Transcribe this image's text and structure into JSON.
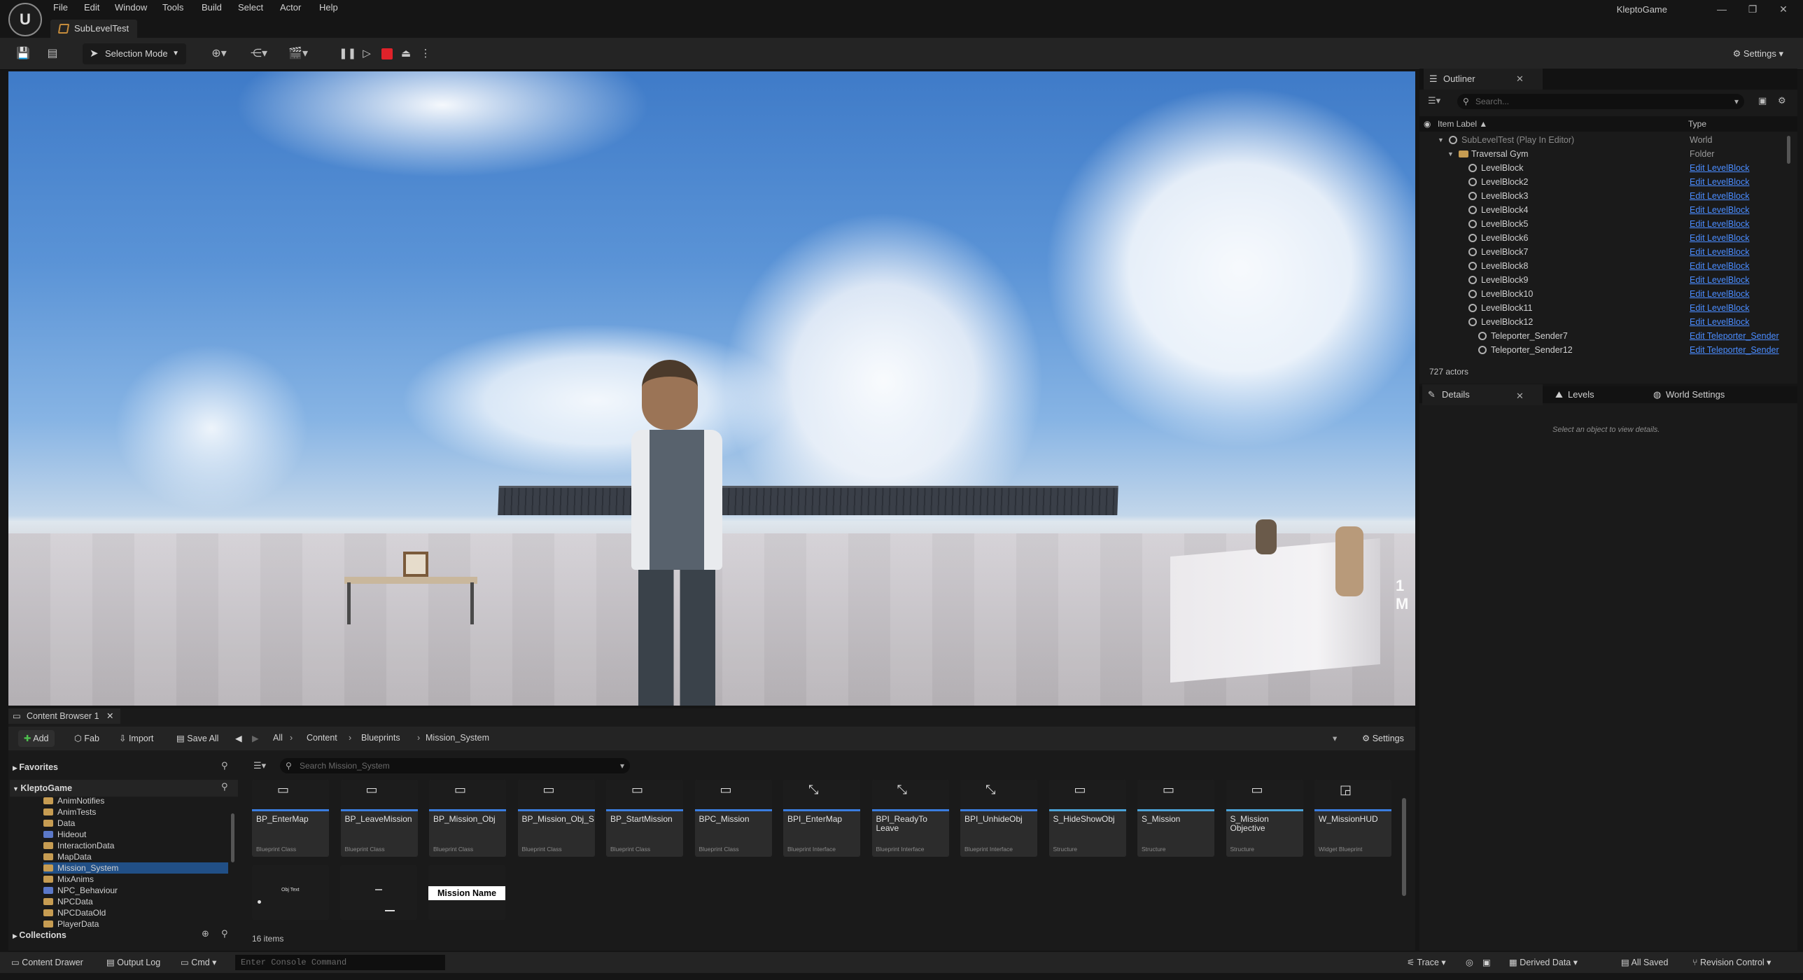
{
  "window": {
    "app_name": "KleptoGame",
    "logo_letter": "U",
    "menu": [
      "File",
      "Edit",
      "Window",
      "Tools",
      "Build",
      "Select",
      "Actor",
      "Help"
    ],
    "level_tab": "SubLevelTest",
    "minimize": "—",
    "maximize": "❐",
    "close": "✕"
  },
  "toolbar": {
    "selection_mode": "Selection Mode",
    "settings": "Settings",
    "icons": [
      "save-icon",
      "content-icon",
      "add-actor-icon",
      "blueprint-icon",
      "cinematics-icon",
      "pause-icon",
      "play-icon",
      "stop-icon",
      "eject-icon"
    ]
  },
  "viewport": {
    "sign_text": "1 M"
  },
  "outliner": {
    "tab": "Outliner",
    "search_placeholder": "Search...",
    "col_label": "Item Label ▲",
    "col_type": "Type",
    "rows": [
      {
        "label": "SubLevelTest (Play In Editor)",
        "type": "World",
        "indent": 0,
        "link": false,
        "dim": true,
        "folder": false
      },
      {
        "label": "Traversal Gym",
        "type": "Folder",
        "indent": 1,
        "link": false,
        "dim": false,
        "folder": true
      },
      {
        "label": "LevelBlock",
        "type": "Edit LevelBlock",
        "indent": 2,
        "link": true,
        "dim": false,
        "folder": false
      },
      {
        "label": "LevelBlock2",
        "type": "Edit LevelBlock",
        "indent": 2,
        "link": true,
        "dim": false,
        "folder": false
      },
      {
        "label": "LevelBlock3",
        "type": "Edit LevelBlock",
        "indent": 2,
        "link": true,
        "dim": false,
        "folder": false
      },
      {
        "label": "LevelBlock4",
        "type": "Edit LevelBlock",
        "indent": 2,
        "link": true,
        "dim": false,
        "folder": false
      },
      {
        "label": "LevelBlock5",
        "type": "Edit LevelBlock",
        "indent": 2,
        "link": true,
        "dim": false,
        "folder": false
      },
      {
        "label": "LevelBlock6",
        "type": "Edit LevelBlock",
        "indent": 2,
        "link": true,
        "dim": false,
        "folder": false
      },
      {
        "label": "LevelBlock7",
        "type": "Edit LevelBlock",
        "indent": 2,
        "link": true,
        "dim": false,
        "folder": false
      },
      {
        "label": "LevelBlock8",
        "type": "Edit LevelBlock",
        "indent": 2,
        "link": true,
        "dim": false,
        "folder": false
      },
      {
        "label": "LevelBlock9",
        "type": "Edit LevelBlock",
        "indent": 2,
        "link": true,
        "dim": false,
        "folder": false
      },
      {
        "label": "LevelBlock10",
        "type": "Edit LevelBlock",
        "indent": 2,
        "link": true,
        "dim": false,
        "folder": false
      },
      {
        "label": "LevelBlock11",
        "type": "Edit LevelBlock",
        "indent": 2,
        "link": true,
        "dim": false,
        "folder": false
      },
      {
        "label": "LevelBlock12",
        "type": "Edit LevelBlock",
        "indent": 2,
        "link": true,
        "dim": false,
        "folder": false
      },
      {
        "label": "Teleporter_Sender7",
        "type": "Edit Teleporter_Sender",
        "indent": 3,
        "link": true,
        "dim": false,
        "folder": false
      },
      {
        "label": "Teleporter_Sender12",
        "type": "Edit Teleporter_Sender",
        "indent": 3,
        "link": true,
        "dim": false,
        "folder": false
      }
    ],
    "actor_count": "727 actors"
  },
  "details": {
    "tab_details": "Details",
    "tab_levels": "Levels",
    "tab_world": "World Settings",
    "empty_message": "Select an object to view details."
  },
  "content_browser": {
    "tab": "Content Browser 1",
    "add": "Add",
    "fab": "Fab",
    "import": "Import",
    "save_all": "Save All",
    "settings": "Settings",
    "breadcrumbs": [
      "All",
      "Content",
      "Blueprints",
      "Mission_System"
    ],
    "favorites": "Favorites",
    "project": "KleptoGame",
    "collections": "Collections",
    "search_placeholder": "Search Mission_System",
    "item_count": "16 items",
    "tree": [
      {
        "name": "AnimNotifies",
        "sel": false,
        "blue": false
      },
      {
        "name": "AnimTests",
        "sel": false,
        "blue": false
      },
      {
        "name": "Data",
        "sel": false,
        "blue": false
      },
      {
        "name": "Hideout",
        "sel": false,
        "blue": true
      },
      {
        "name": "InteractionData",
        "sel": false,
        "blue": false
      },
      {
        "name": "MapData",
        "sel": false,
        "blue": false
      },
      {
        "name": "Mission_System",
        "sel": true,
        "blue": false
      },
      {
        "name": "MixAnims",
        "sel": false,
        "blue": false
      },
      {
        "name": "NPC_Behaviour",
        "sel": false,
        "blue": true
      },
      {
        "name": "NPCData",
        "sel": false,
        "blue": false
      },
      {
        "name": "NPCDataOld",
        "sel": false,
        "blue": false
      },
      {
        "name": "PlayerData",
        "sel": false,
        "blue": false
      }
    ],
    "assets": [
      {
        "name": "BP_EnterMap",
        "cls": "Blueprint Class",
        "kind": "bp"
      },
      {
        "name": "BP_LeaveMission",
        "cls": "Blueprint Class",
        "kind": "bp"
      },
      {
        "name": "BP_Mission_Obj",
        "cls": "Blueprint Class",
        "kind": "bp"
      },
      {
        "name": "BP_Mission_Obj_S",
        "cls": "Blueprint Class",
        "kind": "bp"
      },
      {
        "name": "BP_StartMission",
        "cls": "Blueprint Class",
        "kind": "bp"
      },
      {
        "name": "BPC_Mission",
        "cls": "Blueprint Class",
        "kind": "bp"
      },
      {
        "name": "BPI_EnterMap",
        "cls": "Blueprint Interface",
        "kind": "iface"
      },
      {
        "name": "BPI_ReadyTo Leave",
        "cls": "Blueprint Interface",
        "kind": "iface"
      },
      {
        "name": "BPI_UnhideObj",
        "cls": "Blueprint Interface",
        "kind": "iface"
      },
      {
        "name": "S_HideShowObj",
        "cls": "Structure",
        "kind": "struct"
      },
      {
        "name": "S_Mission",
        "cls": "Structure",
        "kind": "struct"
      },
      {
        "name": "S_Mission Objective",
        "cls": "Structure",
        "kind": "struct"
      },
      {
        "name": "W_MissionHUD",
        "cls": "Widget Blueprint",
        "kind": "widget"
      }
    ],
    "row2_label_objtext": "Obj Text",
    "row2_mission_name": "Mission Name"
  },
  "statusbar": {
    "content_drawer": "Content Drawer",
    "output_log": "Output Log",
    "cmd": "Cmd",
    "console_placeholder": "Enter Console Command",
    "trace": "Trace",
    "derived_data": "Derived Data",
    "all_saved": "All Saved",
    "revision_control": "Revision Control"
  }
}
